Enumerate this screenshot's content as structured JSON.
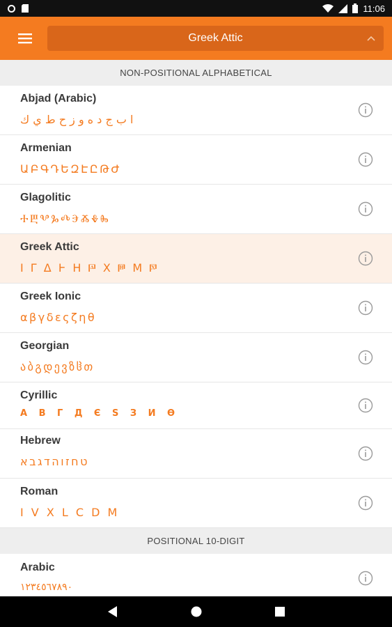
{
  "status_bar": {
    "time": "11:06"
  },
  "app_bar": {
    "selected_system": "Greek Attic"
  },
  "sections": [
    {
      "title": "NON-POSITIONAL ALPHABETICAL",
      "items": [
        {
          "name": "Abjad (Arabic)",
          "sample": "ا ب ج د ه و ز ح ط ي ك"
        },
        {
          "name": "Armenian",
          "sample": "ԱԲԳԴԵԶԷԸԹԺ"
        },
        {
          "name": "Glagolitic",
          "sample": "ⰀⰁⰂⰃⰄⰅⰆⰇⰈ"
        },
        {
          "name": "Greek Attic",
          "sample": "Ι Γ Δ Ͱ Η 𐅄 Χ 𐅅 Μ 𐅆"
        },
        {
          "name": "Greek Ionic",
          "sample": "αβγδεςζηθ"
        },
        {
          "name": "Georgian",
          "sample": "აბგდევზჱთ"
        },
        {
          "name": "Cyrillic",
          "sample": "А В Г Д Є Ѕ З И Ѳ"
        },
        {
          "name": "Hebrew",
          "sample": "אבגדהוזחט"
        },
        {
          "name": "Roman",
          "sample": "I V X L C D M"
        }
      ]
    },
    {
      "title": "POSITIONAL 10-DIGIT",
      "items": [
        {
          "name": "Arabic",
          "sample": "١٢٣٤٥٦٧٨٩٠"
        }
      ]
    }
  ]
}
